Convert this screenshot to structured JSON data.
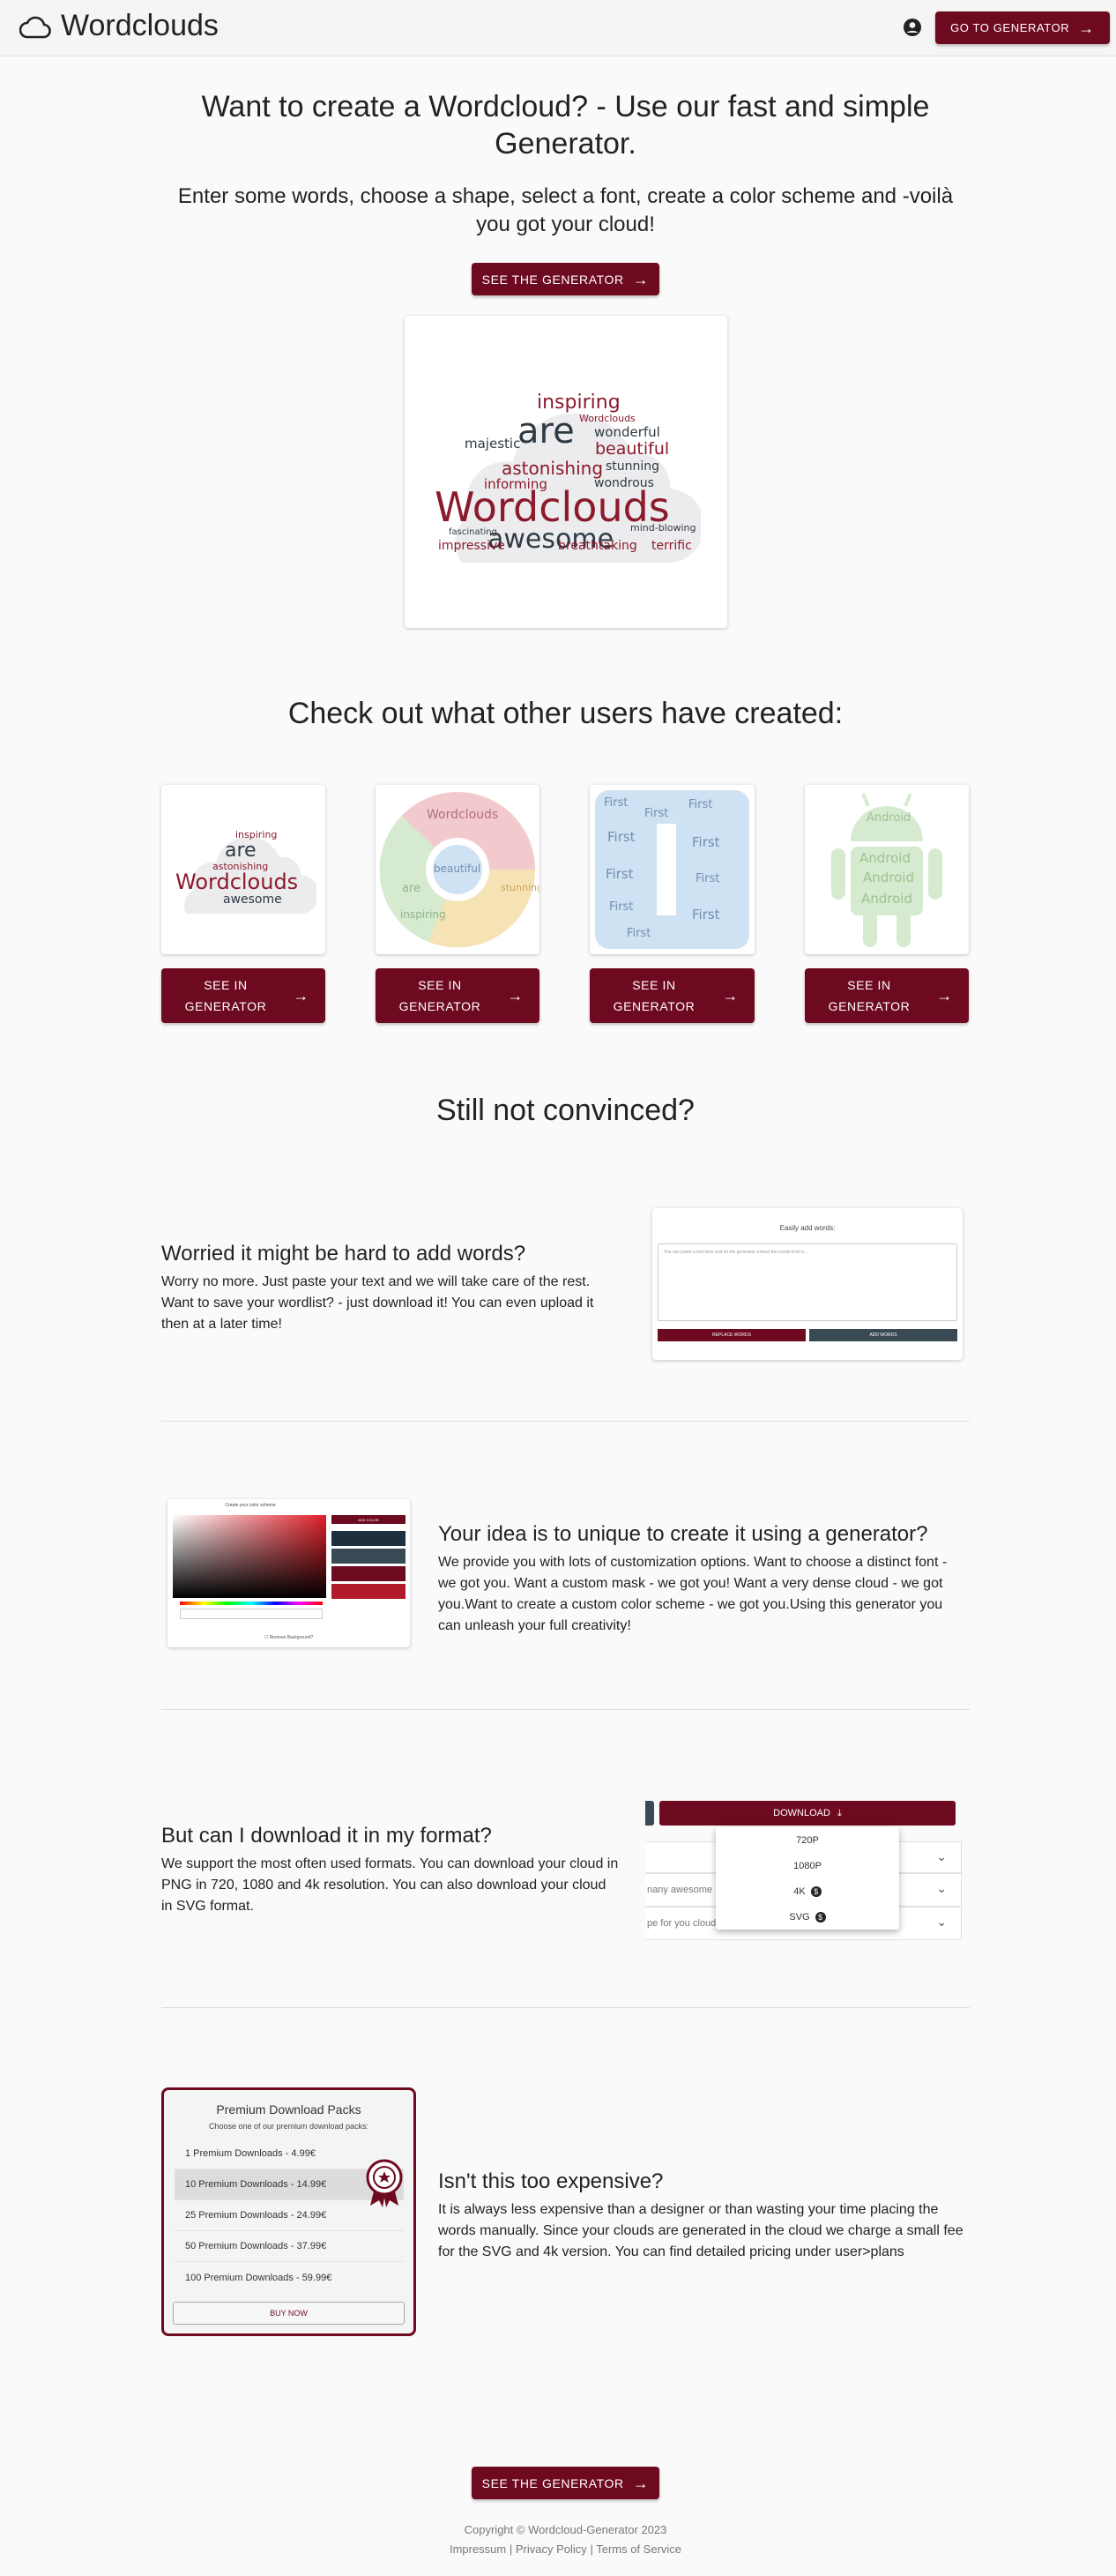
{
  "header": {
    "logo_text": "Wordclouds",
    "cta_label": "GO TO GENERATOR"
  },
  "hero": {
    "title": "Want to create a Wordcloud? - Use our fast and simple Generator.",
    "subtitle": "Enter some words, choose a shape, select a font, create a color scheme and -voilà you got your cloud!",
    "cta_label": "SEE THE GENERATOR",
    "wordcloud_words": [
      "inspiring",
      "are",
      "Wordclouds",
      "wonderful",
      "majestic",
      "beautiful",
      "astonishing",
      "stunning",
      "informing",
      "wondrous",
      "Wordclouds",
      "awesome",
      "impressive",
      "breathtaking",
      "terrific",
      "mind-blowing",
      "fascinating"
    ]
  },
  "gallery": {
    "title": "Check out what other users have created:",
    "button_label": "SEE IN GENERATOR",
    "items": [
      {
        "shape": "cloud",
        "words": [
          "inspiring",
          "are",
          "astonishing",
          "Wordclouds",
          "awesome"
        ]
      },
      {
        "shape": "chrome",
        "words": [
          "Wordclouds",
          "beautiful",
          "are",
          "inspiring",
          "stunning"
        ]
      },
      {
        "shape": "square",
        "words": [
          "First"
        ]
      },
      {
        "shape": "android",
        "words": [
          "Android"
        ]
      }
    ]
  },
  "convince": {
    "title": "Still not convinced?",
    "features": [
      {
        "title": "Worried it might be hard to add words?",
        "body": "Worry no more. Just paste your text and we will take care of the rest. Want to save your wordlist? - just download it! You can even upload it then at a later time!",
        "mock": {
          "heading": "Easily add words:",
          "placeholder": "You can paste a text here and let the generator extract the words from it...",
          "btn_replace": "REPLACE WORDS",
          "btn_add": "ADD WORDS"
        }
      },
      {
        "title": "Your idea is to unique to create it using a generator?",
        "body": "We provide you with lots of customization options. Want to choose a distinct font - we got you. Want a custom mask - we got you! Want a very dense cloud - we got you.Want to create a custom color scheme - we got you.Using this generator you can unleash your full creativity!",
        "mock": {
          "heading": "Create your color scheme",
          "btn_add": "ADD COLOR",
          "swatches": [
            "#1e2f3d",
            "#3a4a55",
            "#6e0a1f",
            "#b01a2a"
          ],
          "checkbox": "Remove Background?"
        }
      },
      {
        "title": "But can I download it in my format?",
        "body": "We support the most often used formats. You can download your cloud in PNG in 720, 1080 and 4k resolution. You can also download your cloud in SVG format.",
        "mock": {
          "download_label": "DOWNLOAD",
          "options": [
            "720P",
            "1080P",
            "4K",
            "SVG"
          ],
          "row2_text": "nany awesome",
          "row3_text": "pe for you cloud"
        }
      },
      {
        "title": "Isn't this too expensive?",
        "body": "It is always less expensive than a designer or than wasting your time placing the words manually. Since your clouds are generated in the cloud we charge a small fee for the SVG and 4k version. You can find detailed pricing under user>plans",
        "mock": {
          "heading": "Premium Download Packs",
          "subheading": "Choose one of our premium download packs:",
          "packs": [
            "1 Premium Downloads - 4.99€",
            "10 Premium Downloads - 14.99€",
            "25 Premium Downloads - 24.99€",
            "50 Premium Downloads - 37.99€",
            "100 Premium Downloads - 59.99€"
          ],
          "buy_label": "BUY NOW"
        }
      }
    ]
  },
  "bottom_cta": {
    "label": "SEE THE GENERATOR"
  },
  "footer": {
    "copyright": "Copyright © Wordcloud-Generator 2023",
    "impressum": "Impressum",
    "privacy": "Privacy Policy",
    "terms": "Terms of Service",
    "separator": "|"
  },
  "colors": {
    "accent": "#6e0a1f",
    "wc_red": "#8b1a2c",
    "wc_dark": "#2e3a44"
  }
}
